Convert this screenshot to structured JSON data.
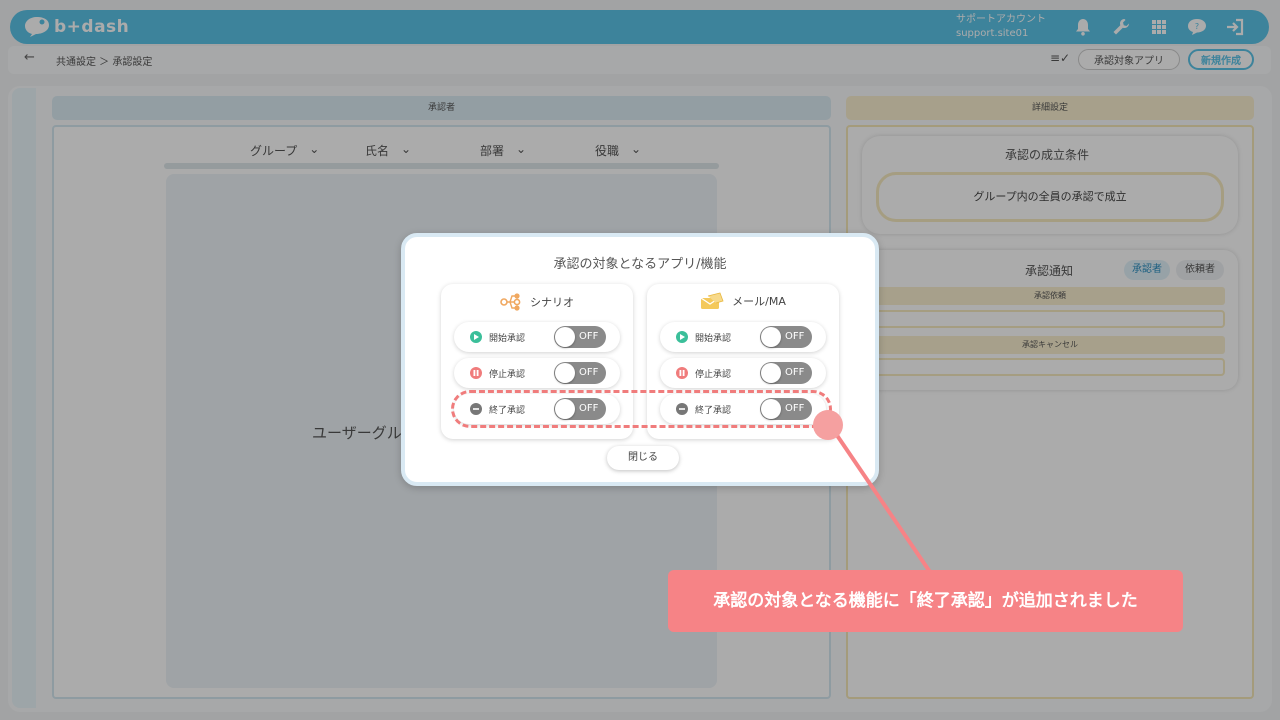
{
  "header": {
    "logo_text": "b+dash",
    "account_name": "サポートアカウント",
    "account_id": "support.site01",
    "icons": [
      "bell-icon",
      "wrench-icon",
      "grid-icon",
      "chat-icon",
      "logout-icon"
    ]
  },
  "breadcrumb": {
    "path": "共通設定 ＞ 承認設定",
    "apps_button": "承認対象アプリ",
    "new_button": "新規作成"
  },
  "approver_section": {
    "title": "承認者",
    "filters": [
      "グループ",
      "氏名",
      "部署",
      "役職"
    ],
    "placeholder": "ユーザーグル"
  },
  "detail_section": {
    "title": "詳細設定",
    "condition_title": "承認の成立条件",
    "condition_value": "グループ内の全員の承認で成立",
    "notify_title": "承認通知",
    "tab_approver": "承認者",
    "tab_requester": "依頼者",
    "notify_request": "承認依頼",
    "notify_cancel": "承認キャンセル"
  },
  "modal": {
    "title": "承認の対象となるアプリ/機能",
    "apps": [
      {
        "name": "シナリオ",
        "icon": "scenario-icon",
        "rows": [
          {
            "label": "開始承認",
            "state": "OFF",
            "icon": "play-icon",
            "color": "#3bbf9a"
          },
          {
            "label": "停止承認",
            "state": "OFF",
            "icon": "pause-icon",
            "color": "#f07c7c"
          },
          {
            "label": "終了承認",
            "state": "OFF",
            "icon": "minus-icon",
            "color": "#777777"
          }
        ]
      },
      {
        "name": "メール/MA",
        "icon": "mail-icon",
        "rows": [
          {
            "label": "開始承認",
            "state": "OFF",
            "icon": "play-icon",
            "color": "#3bbf9a"
          },
          {
            "label": "停止承認",
            "state": "OFF",
            "icon": "pause-icon",
            "color": "#f07c7c"
          },
          {
            "label": "終了承認",
            "state": "OFF",
            "icon": "minus-icon",
            "color": "#777777"
          }
        ]
      }
    ],
    "close_button": "閉じる"
  },
  "callout": {
    "text": "承認の対象となる機能に「終了承認」が追加されました",
    "color": "#f68386"
  },
  "colors": {
    "accent": "#5cc3e8",
    "toggle_off": "#8a8a8a"
  }
}
